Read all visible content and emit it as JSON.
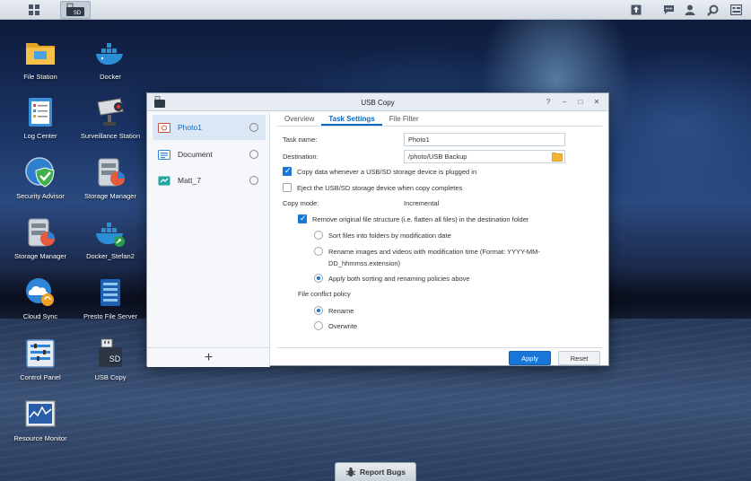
{
  "taskbar": {
    "app_icon_label": "SD",
    "icons": [
      "main-menu-icon",
      "upload-icon",
      "chat-icon",
      "user-icon",
      "search-icon",
      "widgets-icon"
    ]
  },
  "desktop": {
    "icons": [
      {
        "label": "File Station",
        "icon": "folder-icon"
      },
      {
        "label": "Docker",
        "icon": "docker-whale-icon"
      },
      {
        "label": "Log Center",
        "icon": "log-icon"
      },
      {
        "label": "Surveillance Station",
        "icon": "camera-icon"
      },
      {
        "label": "Security Advisor",
        "icon": "shield-check-icon"
      },
      {
        "label": "Storage Manager",
        "icon": "storage-icon"
      },
      {
        "label": "Storage Manager",
        "icon": "storage-icon"
      },
      {
        "label": "Docker_Stefan2",
        "icon": "docker-shortcut-icon"
      },
      {
        "label": "Cloud Sync",
        "icon": "cloud-sync-icon"
      },
      {
        "label": "Presto File Server",
        "icon": "presto-icon"
      },
      {
        "label": "Control Panel",
        "icon": "control-panel-icon"
      },
      {
        "label": "USB Copy",
        "icon": "usb-icon"
      },
      {
        "label": "Resource Monitor",
        "icon": "monitor-chart-icon"
      }
    ]
  },
  "window": {
    "title": "USB Copy",
    "controls": [
      "?",
      "–",
      "□",
      "✕"
    ],
    "tasks": [
      {
        "label": "Photo1",
        "icon": "photo-task-icon",
        "active": true
      },
      {
        "label": "Document",
        "icon": "document-task-icon",
        "active": false
      },
      {
        "label": "Matt_7",
        "icon": "sync-task-icon",
        "active": false
      }
    ],
    "add_label": "+",
    "tabs": [
      {
        "label": "Overview",
        "active": false
      },
      {
        "label": "Task Settings",
        "active": true
      },
      {
        "label": "File Filter",
        "active": false
      }
    ],
    "form": {
      "task_name_label": "Task name:",
      "task_name_value": "Photo1",
      "destination_label": "Destination:",
      "destination_value": "/photo/USB Backup",
      "copy_on_plug_label": "Copy data whenever a USB/SD storage device is plugged in",
      "copy_on_plug_checked": true,
      "eject_label": "Eject the USB/SD storage device when copy completes",
      "eject_checked": false,
      "copy_mode_label": "Copy mode:",
      "copy_mode_value": "Incremental",
      "remove_structure_label": "Remove original file structure (i.e. flatten all files) in the destination folder",
      "remove_structure_checked": true,
      "sort_option": "Sort files into folders by modification date",
      "rename_option_line1": "Rename images and videos with modification time (Format: YYYY-MM-",
      "rename_option_line2": "DD_hhmmss.extension)",
      "both_option": "Apply both sorting and renaming policies above",
      "conflict_label": "File conflict policy",
      "conflict_rename": "Rename",
      "conflict_overwrite": "Overwrite"
    },
    "apply_label": "Apply",
    "reset_label": "Reset"
  },
  "report_bugs_label": "Report Bugs",
  "colors": {
    "accent": "#1776d6",
    "titlebar": "#e6ecf2",
    "sidebar_active": "#dbe7f4"
  }
}
